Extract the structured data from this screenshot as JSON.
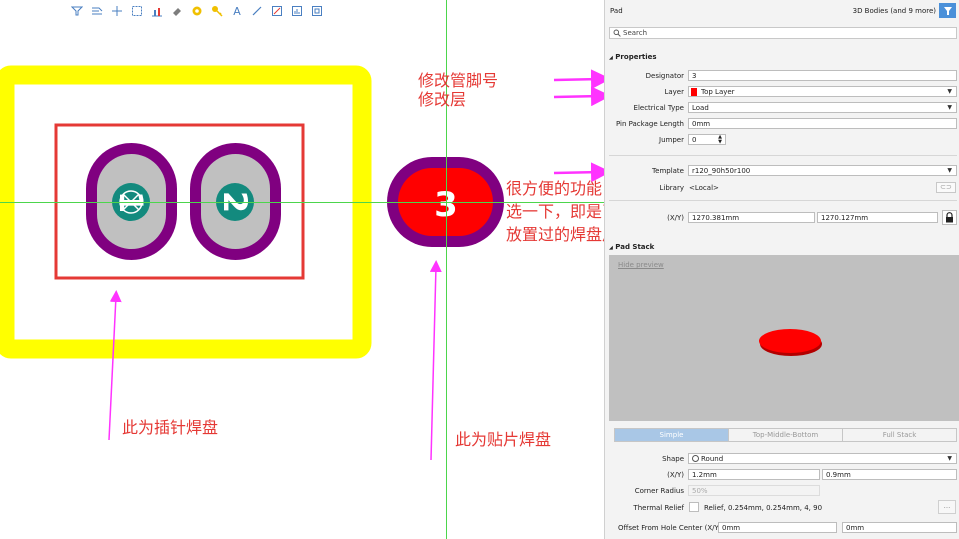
{
  "toolbar": {
    "icons": [
      "filter-icon",
      "route-icon",
      "crosshair-add-icon",
      "select-rect-icon",
      "bar-chart-icon",
      "eraser-icon",
      "via-icon",
      "key-icon",
      "text-tool-icon",
      "line-tool-icon",
      "draw-rect-icon",
      "chart-box-icon",
      "frame-icon"
    ],
    "text_tool": "A"
  },
  "canvas": {
    "pad1_number": "1",
    "pad2_number": "2",
    "pad3_number": "3",
    "colors": {
      "board_outline": "#ffff00",
      "component_outline": "#e53935",
      "pad_ring": "#800080",
      "pad_hole": "#c0c0c0",
      "smd_pad": "#ff0000",
      "annotation": "#e53935",
      "arrow": "#ff33ff",
      "crosshair": "#4cd64c"
    }
  },
  "annotations": {
    "modify_designator": "修改管脚号",
    "modify_layer": "修改层",
    "template_tip_line1": "很方便的功能，点",
    "template_tip_line2": "选一下，即是已经",
    "template_tip_line3": "放置过的焊盘尺寸",
    "through_hole_pad": "此为插针焊盘",
    "smd_pad": "此为贴片焊盘"
  },
  "panel": {
    "title": "Pad",
    "filter_label": "3D Bodies (and 9 more)",
    "search_placeholder": "Search",
    "properties_header": "Properties",
    "designator_label": "Designator",
    "designator_value": "3",
    "layer_label": "Layer",
    "layer_value": "Top Layer",
    "layer_color": "#ff0000",
    "electrical_type_label": "Electrical Type",
    "electrical_type_value": "Load",
    "pin_package_length_label": "Pin Package Length",
    "pin_package_length_value": "0mm",
    "jumper_label": "Jumper",
    "jumper_value": "0",
    "template_label": "Template",
    "template_value": "r120_90h50r100",
    "library_label": "Library",
    "library_value": "<Local>",
    "xy_label": "(X/Y)",
    "x_value": "1270.381mm",
    "y_value": "1270.127mm",
    "pad_stack_header": "Pad Stack",
    "hide_preview": "Hide preview",
    "tabs": [
      "Simple",
      "Top-Middle-Bottom",
      "Full Stack"
    ],
    "active_tab": "Simple",
    "shape_label": "Shape",
    "shape_value": "Round",
    "size_label": "(X/Y)",
    "size_x": "1.2mm",
    "size_y": "0.9mm",
    "corner_radius_label": "Corner Radius",
    "corner_radius_value": "50%",
    "thermal_relief_label": "Thermal Relief",
    "thermal_relief_value": "Relief, 0.254mm, 0.254mm, 4, 90",
    "offset_label": "Offset From Hole Center (X/Y)",
    "offset_x": "0mm",
    "offset_y": "0mm",
    "more_button": "..."
  }
}
